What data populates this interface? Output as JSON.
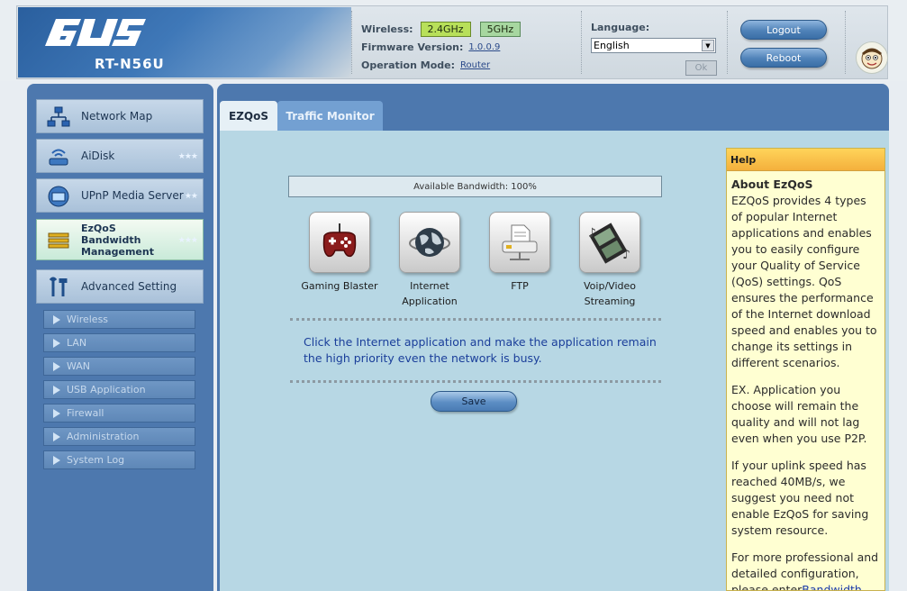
{
  "header": {
    "brand": "/ISUS",
    "model": "RT-N56U",
    "wireless_label": "Wireless:",
    "band_24": "2.4GHz",
    "band_5": "5GHz",
    "firmware_label": "Firmware Version:",
    "firmware_value": "1.0.0.9",
    "mode_label": "Operation Mode:",
    "mode_value": "Router",
    "language_label": "Language:",
    "language_value": "English",
    "ok_label": "Ok",
    "logout_label": "Logout",
    "reboot_label": "Reboot"
  },
  "sidebar": {
    "items": [
      {
        "label": "Network Map",
        "icon": "network-map-icon"
      },
      {
        "label": "AiDisk",
        "icon": "aidisk-icon"
      },
      {
        "label": "UPnP Media Server",
        "icon": "upnp-icon"
      },
      {
        "label": "EzQoS Bandwidth Management",
        "icon": "ezqos-icon"
      },
      {
        "label": "Advanced Setting",
        "icon": "tools-icon"
      }
    ],
    "subitems": [
      "Wireless",
      "LAN",
      "WAN",
      "USB Application",
      "Firewall",
      "Administration",
      "System Log"
    ]
  },
  "tabs": [
    "EZQoS",
    "Traffic Monitor"
  ],
  "main": {
    "bandwidth_text": "Available Bandwidth: 100%",
    "apps": [
      {
        "label": "Gaming Blaster",
        "icon": "gamepad-icon"
      },
      {
        "label": "Internet Application",
        "icon": "globe-icon"
      },
      {
        "label": "FTP",
        "icon": "ftp-icon"
      },
      {
        "label": "Voip/Video Streaming",
        "icon": "film-icon"
      }
    ],
    "description": "Click the Internet application and make the application remain the high priority even the network is busy.",
    "save_label": "Save"
  },
  "help": {
    "header": "Help",
    "title": "About EzQoS",
    "p1": "EZQoS provides 4 types of popular Internet applications and enables you to easily configure your Quality of Service (QoS) settings. QoS ensures the performance of the Internet download speed and enables you to change its settings in different scenarios.",
    "p2": "EX. Application you choose will remain the quality and will not lag even when you use P2P.",
    "p3": "If your uplink speed has reached 40MB/s, we suggest you need not enable EzQoS for saving system resource.",
    "p4": "For more professional and detailed configuration, please enter",
    "p4_link": "Bandwidth"
  },
  "colors": {
    "nav_blue": "#4d78ae",
    "content_bg": "#b7d7e4",
    "help_bg": "#ffffd2",
    "help_header": "#f4b03c",
    "badge_24": "#b8e05a",
    "badge_5": "#a7d7a0"
  }
}
